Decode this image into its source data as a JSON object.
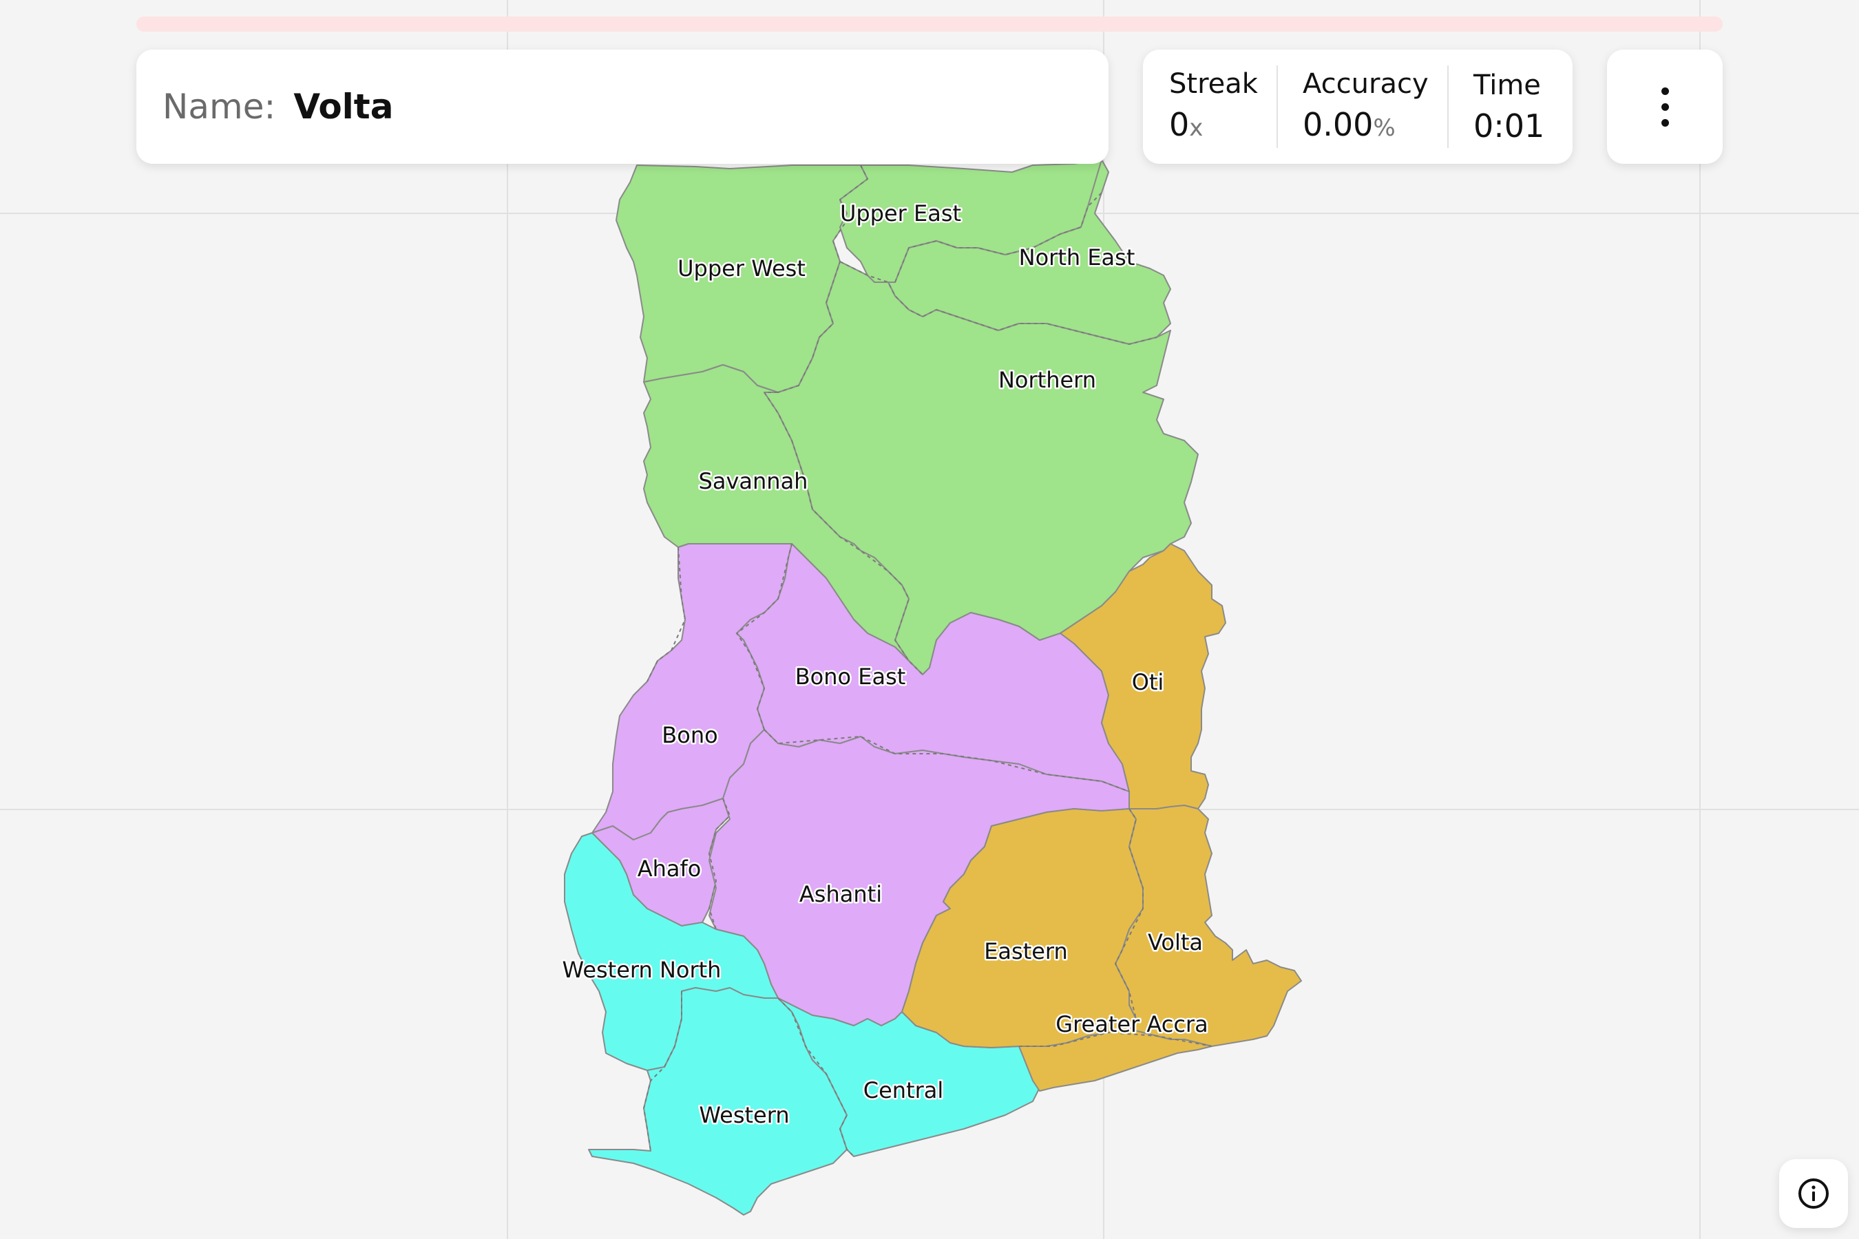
{
  "map": {
    "country": "Ghana",
    "prompt_label": "Name:",
    "prompt_value": "Volta",
    "regions": [
      {
        "id": "upper-west",
        "label": "Upper West",
        "group": "north"
      },
      {
        "id": "upper-east",
        "label": "Upper East",
        "group": "north"
      },
      {
        "id": "north-east",
        "label": "North East",
        "group": "north"
      },
      {
        "id": "northern",
        "label": "Northern",
        "group": "north"
      },
      {
        "id": "savannah",
        "label": "Savannah",
        "group": "north"
      },
      {
        "id": "bono-east",
        "label": "Bono East",
        "group": "middle"
      },
      {
        "id": "bono",
        "label": "Bono",
        "group": "middle"
      },
      {
        "id": "ahafo",
        "label": "Ahafo",
        "group": "middle"
      },
      {
        "id": "ashanti",
        "label": "Ashanti",
        "group": "middle"
      },
      {
        "id": "oti",
        "label": "Oti",
        "group": "east"
      },
      {
        "id": "eastern",
        "label": "Eastern",
        "group": "east"
      },
      {
        "id": "volta",
        "label": "Volta",
        "group": "east"
      },
      {
        "id": "greater-accra",
        "label": "Greater Accra",
        "group": "east"
      },
      {
        "id": "western-north",
        "label": "Western North",
        "group": "south"
      },
      {
        "id": "western",
        "label": "Western",
        "group": "south"
      },
      {
        "id": "central",
        "label": "Central",
        "group": "south"
      }
    ],
    "group_colors": {
      "north": "#9fe38a",
      "middle": "#dfaaf7",
      "east": "#e5bc4a",
      "south": "#66fbef"
    }
  },
  "stats": {
    "streak_label": "Streak",
    "streak_value": "0",
    "streak_unit": "x",
    "accuracy_label": "Accuracy",
    "accuracy_value": "0.00",
    "accuracy_unit": "%",
    "time_label": "Time",
    "time_value": "0:01"
  },
  "progress": {
    "fraction": 0
  },
  "icons": {
    "menu": "more-vertical-icon",
    "info": "info-icon"
  },
  "colors": {
    "progress_track": "#fde3e3",
    "progress_fill": "#f06b6b",
    "background": "#f4f4f4"
  }
}
